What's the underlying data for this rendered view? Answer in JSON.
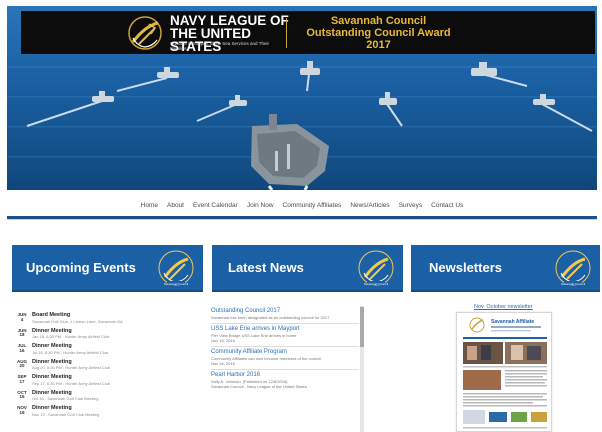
{
  "header": {
    "org_title_line1": "NAVY LEAGUE OF",
    "org_title_line2": "THE UNITED STATES",
    "org_subtitle": "Civilians in Support of the Sea Services and Their Families",
    "award_line1": "Savannah Council",
    "award_line2": "Outstanding Council Award",
    "award_year": "2017"
  },
  "nav": {
    "items": [
      "Home",
      "About",
      "Event Calendar",
      "Join Now",
      "Community Affiliates",
      "News/Articles",
      "Surveys",
      "Contact Us"
    ]
  },
  "sections": {
    "upcoming_events": "Upcoming Events",
    "latest_news": "Latest News",
    "newsletters": "Newsletters",
    "seal_text": "Savannah Council"
  },
  "events": [
    {
      "month": "JUN",
      "day": "4",
      "title": "Board Meeting",
      "detail": "Savannah Golf Club, 1 Lemon Lane, Savannah GA"
    },
    {
      "month": "JUN",
      "day": "18",
      "title": "Dinner Meeting",
      "detail": "Jan 18, 6:30 PM - Hunter Army Airfield Club"
    },
    {
      "month": "JUL",
      "day": "16",
      "title": "Dinner Meeting",
      "detail": "Jul 16, 6:30 PM - Hunter Army Airfield Club"
    },
    {
      "month": "AUG",
      "day": "20",
      "title": "Dinner Meeting",
      "detail": "Aug 20, 6:30 PM - Hunter Army Airfield Club"
    },
    {
      "month": "SEP",
      "day": "17",
      "title": "Dinner Meeting",
      "detail": "Sep 17, 6:30 PM - Hunter Army Airfield Club"
    },
    {
      "month": "OCT",
      "day": "15",
      "title": "Dinner Meeting",
      "detail": "Oct 15 - Savannah Golf Club Meeting"
    },
    {
      "month": "NOV",
      "day": "19",
      "title": "Dinner Meeting",
      "detail": "Nov 19 - Savannah Golf Club Meeting"
    }
  ],
  "news": [
    {
      "title": "Outstanding Council 2017",
      "meta": "Savannah has been designated as an outstanding council for 2017"
    },
    {
      "title": "USS Lake Erie arrives in Mayport",
      "meta": "Pier View Bridge USS Lake Erie arrives in home"
    },
    {
      "title": "",
      "meta": "Nov 18, 2016"
    },
    {
      "title": "Community Affiliate Program",
      "meta": "Community Affiliates can now become members of the council"
    },
    {
      "title": "",
      "meta": "Nov 16, 2016"
    },
    {
      "title": "Pearl Harbor 2016",
      "meta": "Sally A. Johnson, (Published on 12/8/2016)"
    },
    {
      "title": "",
      "meta": "Savannah Council - Navy League of the United States"
    }
  ],
  "newsletter": {
    "link_text": "Nov. October newsletter",
    "masthead": "Savannah Affiliate"
  },
  "colors": {
    "banner_blue": "#1b5fa5",
    "gold": "#e9b838",
    "link_blue": "#2a6fb5"
  }
}
